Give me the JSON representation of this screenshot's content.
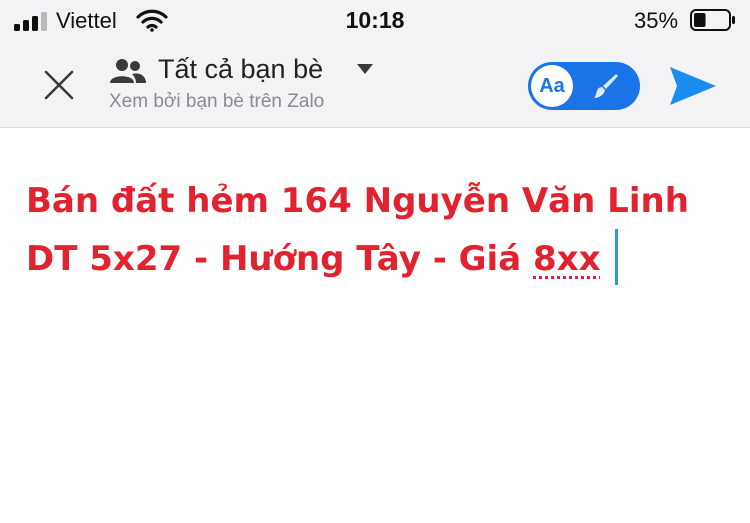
{
  "status_bar": {
    "carrier": "Viettel",
    "time": "10:18",
    "battery_percent": "35%",
    "battery_level": 0.35,
    "signal_bars": 3,
    "signal_bars_total": 4
  },
  "header": {
    "close_icon": "close-icon",
    "audience": {
      "icon": "people-icon",
      "label": "Tất cả bạn bè",
      "subtitle": "Xem bởi bạn bè trên Zalo"
    },
    "style_toggle": {
      "font_label": "Aa",
      "secondary_icon": "paint-brush-icon"
    },
    "send_icon": "send-icon"
  },
  "composer": {
    "text_main": "Bán đất hẻm 164 Nguyễn Văn Linh DT 5x27 - Hướng Tây - Giá ",
    "text_flagged": "8xx"
  },
  "colors": {
    "accent": "#1b73e8",
    "post_text": "#e3222f",
    "caret": "#2a9be0",
    "bar_background": "#f3f3f5"
  }
}
